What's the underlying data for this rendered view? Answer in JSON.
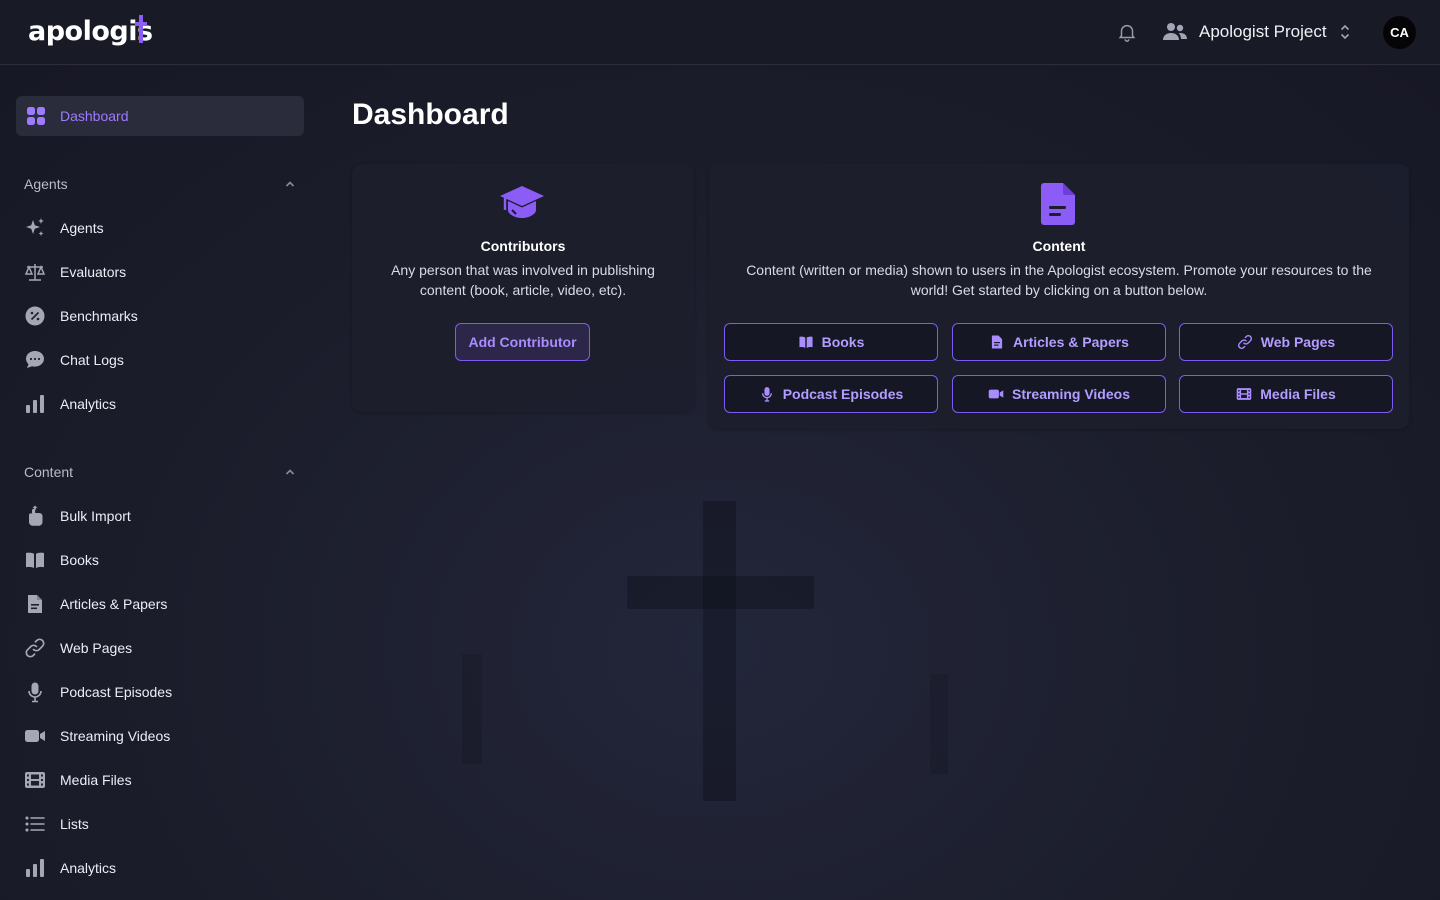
{
  "header": {
    "logo_text": "apologis",
    "project_name": "Apologist Project",
    "avatar_initials": "CA"
  },
  "sidebar": {
    "active_item": {
      "label": "Dashboard",
      "icon": "grid-icon"
    },
    "sections": [
      {
        "title": "Agents",
        "expanded": true,
        "items": [
          {
            "label": "Agents",
            "icon": "sparkles-icon"
          },
          {
            "label": "Evaluators",
            "icon": "scale-icon"
          },
          {
            "label": "Benchmarks",
            "icon": "badge-percent-icon"
          },
          {
            "label": "Chat Logs",
            "icon": "chat-bubble-icon"
          },
          {
            "label": "Analytics",
            "icon": "bar-chart-icon"
          }
        ]
      },
      {
        "title": "Content",
        "expanded": true,
        "items": [
          {
            "label": "Bulk Import",
            "icon": "hand-upload-icon"
          },
          {
            "label": "Books",
            "icon": "book-open-icon"
          },
          {
            "label": "Articles & Papers",
            "icon": "document-icon"
          },
          {
            "label": "Web Pages",
            "icon": "link-icon"
          },
          {
            "label": "Podcast Episodes",
            "icon": "microphone-icon"
          },
          {
            "label": "Streaming Videos",
            "icon": "video-camera-icon"
          },
          {
            "label": "Media Files",
            "icon": "film-icon"
          },
          {
            "label": "Lists",
            "icon": "list-icon"
          },
          {
            "label": "Analytics",
            "icon": "bar-chart-icon"
          }
        ]
      }
    ]
  },
  "main": {
    "title": "Dashboard",
    "contributors_card": {
      "title": "Contributors",
      "description": "Any person that was involved in publishing content (book, article, video, etc).",
      "button": "Add Contributor"
    },
    "content_card": {
      "title": "Content",
      "description": "Content (written or media) shown to users in the Apologist ecosystem. Promote your resources to the world! Get started by clicking on a button below.",
      "buttons": [
        {
          "label": "Books",
          "icon": "book-open-icon"
        },
        {
          "label": "Articles & Papers",
          "icon": "document-icon"
        },
        {
          "label": "Web Pages",
          "icon": "link-icon"
        },
        {
          "label": "Podcast Episodes",
          "icon": "microphone-icon"
        },
        {
          "label": "Streaming Videos",
          "icon": "video-camera-icon"
        },
        {
          "label": "Media Files",
          "icon": "film-icon"
        }
      ]
    }
  },
  "colors": {
    "accent": "#7c5cf0",
    "accent_text": "#9d7bff",
    "background": "#1a1c28",
    "header_bg": "#181a26"
  }
}
